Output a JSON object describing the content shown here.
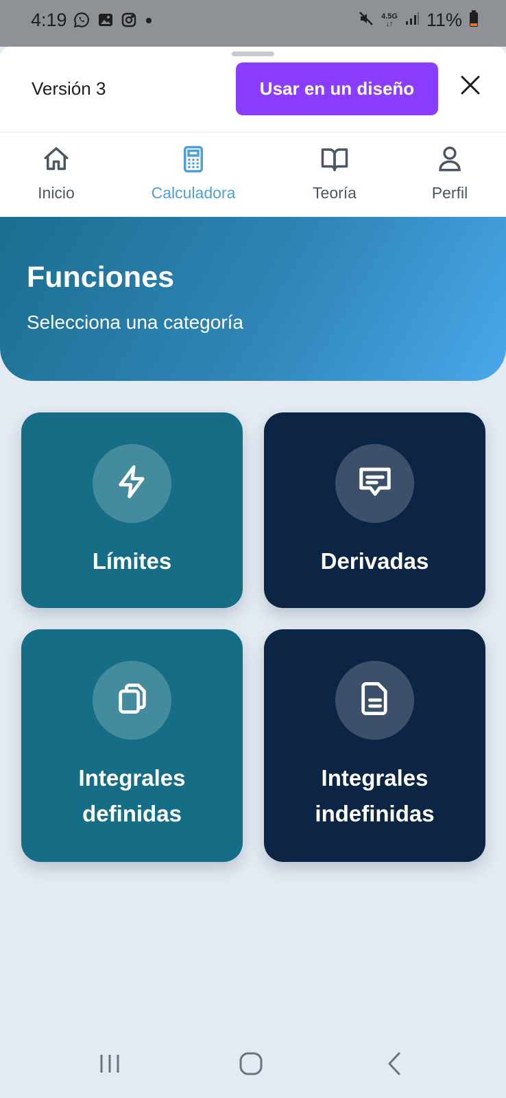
{
  "status_bar": {
    "time": "4:19",
    "battery_percent": "11%",
    "network": "4.5G",
    "left_icons": [
      "whatsapp-icon",
      "gallery-icon",
      "instagram-icon",
      "dot-icon"
    ],
    "right_icons": [
      "mute-icon",
      "network-icon",
      "signal-icon",
      "battery-icon"
    ]
  },
  "sheet": {
    "version_label": "Versión 3",
    "use_button_label": "Usar en un diseño",
    "close_icon": "close-icon"
  },
  "nav": {
    "items": [
      {
        "label": "Inicio",
        "icon": "home-icon",
        "active": false
      },
      {
        "label": "Calculadora",
        "icon": "calculator-icon",
        "active": true
      },
      {
        "label": "Teoría",
        "icon": "book-icon",
        "active": false
      },
      {
        "label": "Perfil",
        "icon": "user-icon",
        "active": false
      }
    ]
  },
  "hero": {
    "title": "Funciones",
    "subtitle": "Selecciona una categoría"
  },
  "categories": [
    {
      "label": "Límites",
      "icon": "lightning-icon",
      "color": "#166e86"
    },
    {
      "label": "Derivadas",
      "icon": "message-icon",
      "color": "#0c2544"
    },
    {
      "label": "Integrales\ndefinidas",
      "icon": "copy-icon",
      "color": "#166e86"
    },
    {
      "label": "Integrales\nindefinidas",
      "icon": "document-icon",
      "color": "#0c2544"
    }
  ],
  "colors": {
    "accent": "#4d9fd8",
    "button": "#8b3dff",
    "teal_card": "#166e86",
    "navy_card": "#0c2544"
  }
}
